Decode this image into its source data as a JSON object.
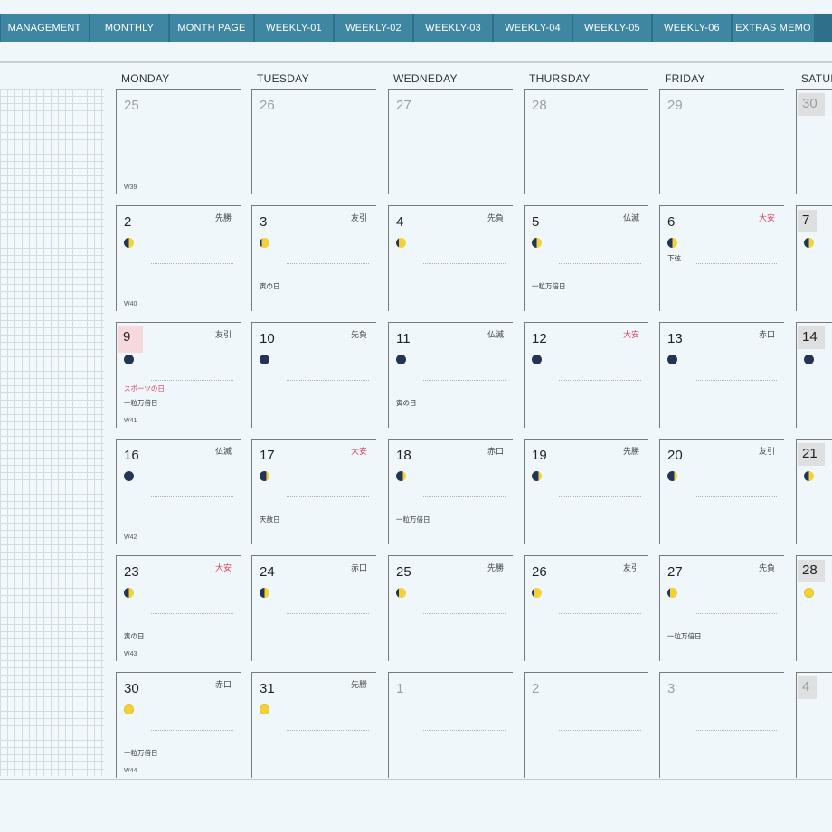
{
  "tabs": [
    "MANAGEMENT",
    "MONTHLY",
    "MONTH PAGE",
    "WEEKLY-01",
    "WEEKLY-02",
    "WEEKLY-03",
    "WEEKLY-04",
    "WEEKLY-05",
    "WEEKLY-06",
    "EXTRAS MEMO"
  ],
  "weekdays": [
    "MONDAY",
    "TUESDAY",
    "WEDNEDAY",
    "THURSDAY",
    "FRIDAY",
    "SATURDAY"
  ],
  "weeks": [
    {
      "label": "W39",
      "days": [
        {
          "n": "25",
          "other": true
        },
        {
          "n": "26",
          "other": true
        },
        {
          "n": "27",
          "other": true
        },
        {
          "n": "28",
          "other": true
        },
        {
          "n": "29",
          "other": true
        },
        {
          "n": "30",
          "other": true,
          "sat": true
        }
      ]
    },
    {
      "label": "W40",
      "days": [
        {
          "n": "2",
          "rokuyo": "先勝",
          "moon": "q-first"
        },
        {
          "n": "3",
          "rokuyo": "友引",
          "moon": "gib-wax",
          "notes": [
            {
              "t": "寅の日"
            }
          ]
        },
        {
          "n": "4",
          "rokuyo": "先負",
          "moon": "gib-wax"
        },
        {
          "n": "5",
          "rokuyo": "仏滅",
          "moon": "q-first",
          "notes": [
            {
              "t": "一粒万倍日"
            }
          ]
        },
        {
          "n": "6",
          "rokuyo": "大安",
          "rokuyoRed": true,
          "moon": "q-first",
          "notes": [
            {
              "t": "下弦",
              "top": true
            }
          ]
        },
        {
          "n": "7",
          "moon": "q-first",
          "sat": true
        }
      ]
    },
    {
      "label": "W41",
      "days": [
        {
          "n": "9",
          "rokuyo": "友引",
          "moon": "new",
          "hol": true,
          "notes": [
            {
              "t": "スポーツの日",
              "red": true
            },
            {
              "t": "一粒万倍日"
            }
          ]
        },
        {
          "n": "10",
          "rokuyo": "先負",
          "moon": "new"
        },
        {
          "n": "11",
          "rokuyo": "仏滅",
          "moon": "new",
          "notes": [
            {
              "t": "寅の日"
            }
          ]
        },
        {
          "n": "12",
          "rokuyo": "大安",
          "rokuyoRed": true,
          "moon": "new"
        },
        {
          "n": "13",
          "rokuyo": "赤口",
          "moon": "new"
        },
        {
          "n": "14",
          "moon": "new",
          "sat": true
        }
      ]
    },
    {
      "label": "W42",
      "days": [
        {
          "n": "16",
          "rokuyo": "仏滅",
          "moon": "new"
        },
        {
          "n": "17",
          "rokuyo": "大安",
          "rokuyoRed": true,
          "moon": "cres-wax",
          "notes": [
            {
              "t": "天赦日"
            }
          ]
        },
        {
          "n": "18",
          "rokuyo": "赤口",
          "moon": "cres-wax",
          "notes": [
            {
              "t": "一粒万倍日"
            }
          ]
        },
        {
          "n": "19",
          "rokuyo": "先勝",
          "moon": "cres-wax"
        },
        {
          "n": "20",
          "rokuyo": "友引",
          "moon": "cres-wax"
        },
        {
          "n": "21",
          "moon": "q-first",
          "sat": true
        }
      ]
    },
    {
      "label": "W43",
      "days": [
        {
          "n": "23",
          "rokuyo": "大安",
          "rokuyoRed": true,
          "moon": "q-first",
          "notes": [
            {
              "t": "寅の日"
            }
          ]
        },
        {
          "n": "24",
          "rokuyo": "赤口",
          "moon": "q-first"
        },
        {
          "n": "25",
          "rokuyo": "先勝",
          "moon": "gib-wax"
        },
        {
          "n": "26",
          "rokuyo": "友引",
          "moon": "gib-wax"
        },
        {
          "n": "27",
          "rokuyo": "先負",
          "moon": "gib-wax",
          "notes": [
            {
              "t": "一粒万倍日"
            }
          ]
        },
        {
          "n": "28",
          "moon": "full",
          "sat": true
        }
      ]
    },
    {
      "label": "W44",
      "days": [
        {
          "n": "30",
          "rokuyo": "赤口",
          "moon": "full",
          "notes": [
            {
              "t": "一粒万倍日"
            }
          ]
        },
        {
          "n": "31",
          "rokuyo": "先勝",
          "moon": "full"
        },
        {
          "n": "1",
          "other": true
        },
        {
          "n": "2",
          "other": true
        },
        {
          "n": "3",
          "other": true
        },
        {
          "n": "4",
          "other": true,
          "sat": true
        }
      ]
    }
  ]
}
